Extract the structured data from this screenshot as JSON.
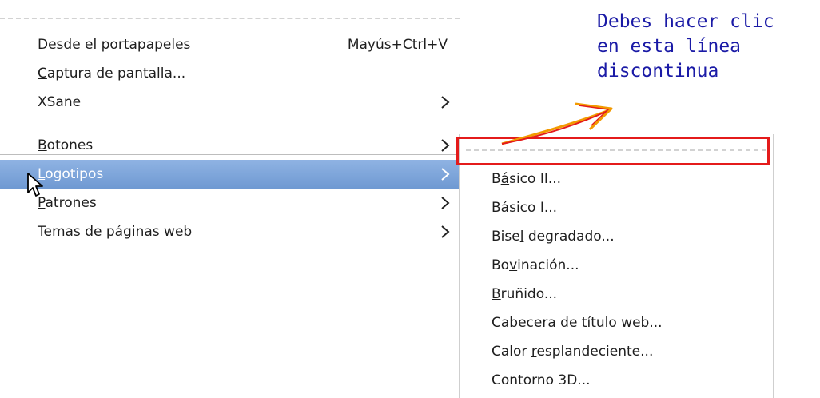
{
  "menu": {
    "items": [
      {
        "label_pre": "Desde el por",
        "label_u": "t",
        "label_post": "apapeles",
        "shortcut": "Mayús+Ctrl+V"
      },
      {
        "label_pre": "",
        "label_u": "C",
        "label_post": "aptura de pantalla..."
      },
      {
        "label_pre": "XSane",
        "label_u": "",
        "label_post": ""
      },
      {
        "label_pre": "",
        "label_u": "B",
        "label_post": "otones"
      },
      {
        "label_pre": "",
        "label_u": "L",
        "label_post": "ogotipos"
      },
      {
        "label_pre": "",
        "label_u": "P",
        "label_post": "atrones"
      },
      {
        "label_pre": "Temas de páginas ",
        "label_u": "w",
        "label_post": "eb"
      }
    ]
  },
  "submenu": {
    "items": [
      {
        "pre": "B",
        "u": "á",
        "post": "sico II..."
      },
      {
        "pre": "",
        "u": "B",
        "post": "ásico I..."
      },
      {
        "pre": "Bise",
        "u": "l",
        "post": " degradado..."
      },
      {
        "pre": "Bo",
        "u": "v",
        "post": "inación..."
      },
      {
        "pre": "",
        "u": "B",
        "post": "ruñido..."
      },
      {
        "pre": "Cabecera de título web...",
        "u": "",
        "post": ""
      },
      {
        "pre": "Calor ",
        "u": "r",
        "post": "esplandeciente..."
      },
      {
        "pre": "Contorno 3D...",
        "u": "",
        "post": ""
      }
    ]
  },
  "annotation": {
    "text": "Debes hacer clic\nen esta línea\ndiscontinua"
  },
  "colors": {
    "highlight": "#7aa2d9",
    "annotation_box": "#e41b1b",
    "annotation_text": "#1a1aa6",
    "arrow": "#f29a00"
  },
  "icons": {
    "submenu_arrow": "chevron-right-icon",
    "pointer": "mouse-cursor-icon"
  }
}
